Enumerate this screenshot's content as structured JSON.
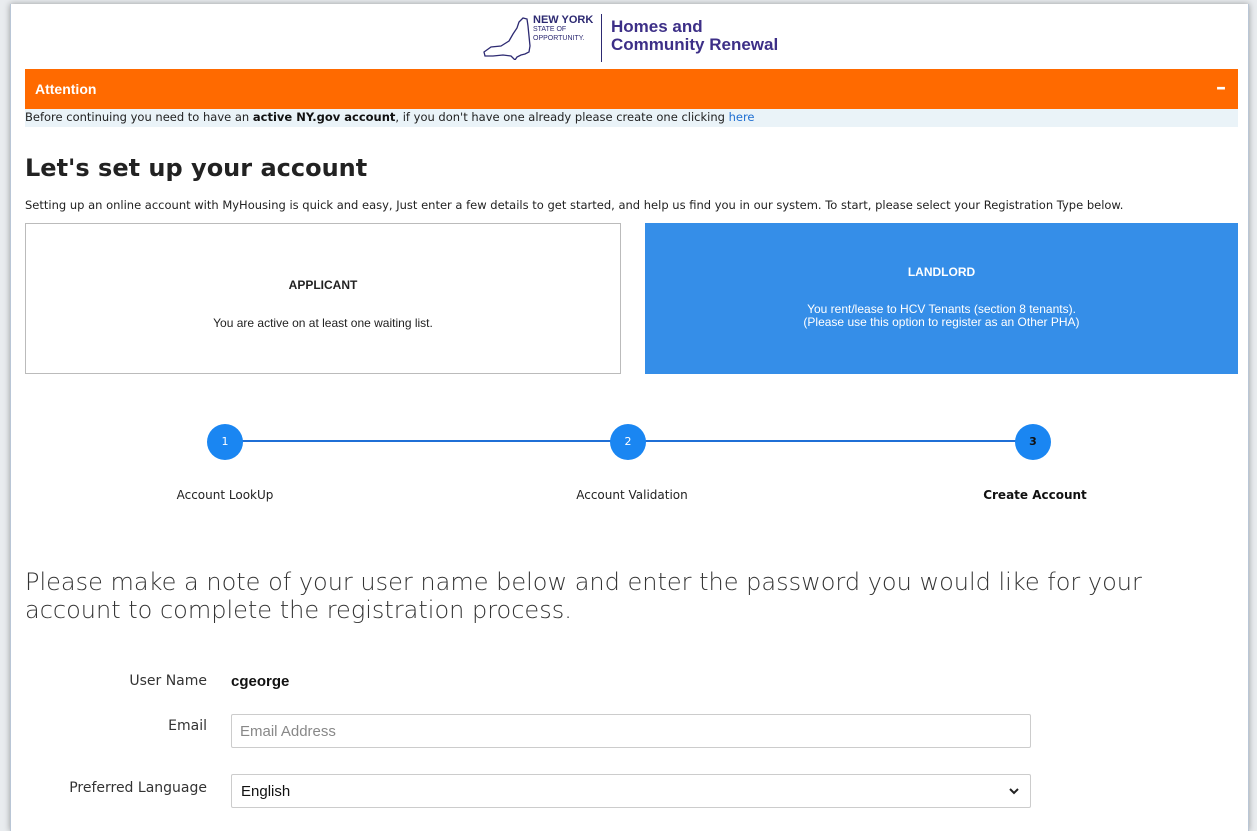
{
  "header": {
    "state_line1": "NEW YORK",
    "state_line2": "STATE OF",
    "state_line3": "OPPORTUNITY.",
    "agency_line1": "Homes and",
    "agency_line2": "Community Renewal"
  },
  "attention": {
    "title": "Attention",
    "collapse_glyph": "–",
    "text_before": "Before continuing you need to have an ",
    "text_bold": "active NY.gov account",
    "text_after": ", if you don't have one already please create one clicking ",
    "link_text": "here"
  },
  "page": {
    "title": "Let's set up your account",
    "intro": "Setting up an online account with MyHousing is quick and easy, Just enter a few details to get started, and help us find you in our system. To start, please select your Registration Type below."
  },
  "registration_types": {
    "applicant": {
      "title": "APPLICANT",
      "description": "You are active on at least one waiting list."
    },
    "landlord": {
      "title": "LANDLORD",
      "description_line1": "You rent/lease to HCV Tenants (section 8 tenants).",
      "description_line2": "(Please use this option to register as an Other PHA)",
      "selected": true
    }
  },
  "stepper": {
    "steps": [
      {
        "number": "1",
        "label": "Account LookUp"
      },
      {
        "number": "2",
        "label": "Account Validation"
      },
      {
        "number": "3",
        "label": "Create Account",
        "active": true
      }
    ]
  },
  "form": {
    "note": "Please make a note of your user name below and enter the password you would like for your account to complete the registration process.",
    "username_label": "User Name",
    "username_value": "cgeorge",
    "email_label": "Email",
    "email_placeholder": "Email Address",
    "email_value": "",
    "language_label": "Preferred Language",
    "language_selected": "English"
  },
  "colors": {
    "attention_bg": "#ff6a00",
    "landlord_bg": "#358ee8",
    "step_circle": "#1a86f2",
    "step_line": "#1f6fd6",
    "logo_purple": "#3d2f87"
  },
  "icons": {
    "state_map": "ny-state-outline-icon",
    "select_arrow": "chevron-down-icon"
  }
}
